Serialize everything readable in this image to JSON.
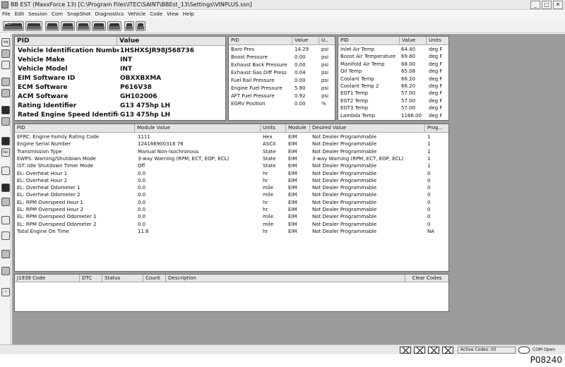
{
  "window": {
    "title": "BB EST (MaxxForce 13) [C:\\Program Files\\ITEC\\SAINT\\BBEst_13\\Settings\\VINPLUS.ssn]",
    "minimize": "_",
    "maximize": "□",
    "close": "✕"
  },
  "menu": [
    "File",
    "Edit",
    "Session",
    "Com",
    "SnapShot",
    "Diagnostics",
    "Vehicle",
    "Code",
    "View",
    "Help"
  ],
  "toolbar": {
    "buttons": [
      {
        "label": "ACT",
        "icon": "act-icon"
      },
      {
        "label": "",
        "icon": "module-connect-icon"
      },
      {
        "label": "",
        "icon": "module-icon"
      },
      {
        "label": "",
        "icon": "module-icon"
      },
      {
        "label": "",
        "icon": "module-icon"
      },
      {
        "label": "",
        "icon": "module-icon"
      },
      {
        "label": "",
        "icon": "module-icon"
      },
      {
        "label": "",
        "icon": "tool-icon"
      },
      {
        "label": "",
        "icon": "settings-icon"
      }
    ]
  },
  "sidebar": {
    "icons": [
      {
        "name": "vin-icon",
        "label": "VIN"
      },
      {
        "name": "tree-icon",
        "label": ""
      },
      {
        "name": "grid-icon",
        "label": ""
      },
      {
        "name": "gauge-icon",
        "label": ""
      },
      {
        "name": "engine-icon",
        "label": ""
      },
      {
        "name": "truck-icon",
        "label": ""
      },
      {
        "name": "test-icon",
        "label": ""
      },
      {
        "name": "camera-icon",
        "label": ""
      },
      {
        "name": "rec-icon",
        "label": "REC"
      },
      {
        "name": "stop-icon",
        "label": ""
      },
      {
        "name": "print-icon",
        "label": ""
      },
      {
        "name": "report-icon",
        "label": ""
      },
      {
        "name": "chart-icon",
        "label": ""
      },
      {
        "name": "calc-icon",
        "label": ""
      },
      {
        "name": "folder-icon",
        "label": ""
      },
      {
        "name": "hand-icon",
        "label": ""
      },
      {
        "name": "help-icon",
        "label": "?"
      }
    ]
  },
  "vin_panel": {
    "headers": [
      "PID",
      "Value"
    ],
    "rows": [
      {
        "pid": "Vehicle Identification Number",
        "value": "1HSHXSJR98J568736"
      },
      {
        "pid": "Vehicle Make",
        "value": "INT"
      },
      {
        "pid": "Vehicle Model",
        "value": "INT"
      },
      {
        "pid": "EIM Software ID",
        "value": "OBXXBXMA"
      },
      {
        "pid": "ECM Software",
        "value": "P616V38"
      },
      {
        "pid": "ACM Software",
        "value": "GH102006"
      },
      {
        "pid": "Rating Identifier",
        "value": "G13 475hp LH"
      },
      {
        "pid": "Rated Engine Speed Identifier",
        "value": "G13 475hp LH"
      }
    ]
  },
  "pid_panel_1": {
    "headers": [
      "PID",
      "Value",
      "U.."
    ],
    "rows": [
      {
        "pid": "Baro Pres",
        "value": "14.29",
        "unit": "psi"
      },
      {
        "pid": "Boost Pressure",
        "value": "0.00",
        "unit": "psi"
      },
      {
        "pid": "Exhaust Back Pressure",
        "value": "0.00",
        "unit": "psi"
      },
      {
        "pid": "Exhaust Gas Diff Press",
        "value": "0.04",
        "unit": "psi"
      },
      {
        "pid": "Fuel Rail Pressure",
        "value": "0.00",
        "unit": "psi"
      },
      {
        "pid": "Engine Fuel Pressure",
        "value": "5.80",
        "unit": "psi"
      },
      {
        "pid": "AFT Fuel Pressure",
        "value": "0.92",
        "unit": "psi"
      },
      {
        "pid": "EGRV Position",
        "value": "0.00",
        "unit": "%"
      }
    ]
  },
  "pid_panel_2": {
    "headers": [
      "PID",
      "Value",
      "Units"
    ],
    "rows": [
      {
        "pid": "Inlet Air Temp",
        "value": "64.40",
        "unit": "deg F"
      },
      {
        "pid": "Boost Air Temperature",
        "value": "69.80",
        "unit": "deg F"
      },
      {
        "pid": "Manifold Air Temp",
        "value": "68.00",
        "unit": "deg F"
      },
      {
        "pid": "Oil Temp",
        "value": "65.08",
        "unit": "deg F"
      },
      {
        "pid": "Coolant Temp",
        "value": "66.20",
        "unit": "deg F"
      },
      {
        "pid": "Coolant Temp 2",
        "value": "66.20",
        "unit": "deg F"
      },
      {
        "pid": "EGT1 Temp",
        "value": "57.00",
        "unit": "deg F"
      },
      {
        "pid": "EGT2 Temp",
        "value": "57.00",
        "unit": "deg F"
      },
      {
        "pid": "EGT3 Temp",
        "value": "57.00",
        "unit": "deg F"
      },
      {
        "pid": "Lambda Temp",
        "value": "1166.00",
        "unit": "deg F"
      }
    ]
  },
  "module_panel": {
    "headers": [
      "PID",
      "Module Value",
      "Units",
      "Module",
      "Desired Value",
      "Prog..."
    ],
    "rows": [
      {
        "pid": "EFRC: Engine Family Rating Code",
        "value": "1111",
        "unit": "Hex",
        "module": "EIM",
        "desired": "Not Dealer Programmable",
        "prog": "1"
      },
      {
        "pid": "Engine Serial Number",
        "value": "124166900316 76",
        "unit": "ASCII",
        "module": "EIM",
        "desired": "Not Dealer Programmable",
        "prog": "1"
      },
      {
        "pid": "Transmission Type",
        "value": "Manual Non-Isochronous",
        "unit": "State",
        "module": "EIM",
        "desired": "Not Dealer Programmable",
        "prog": "1"
      },
      {
        "pid": "EWPS: Warning/Shutdown Mode",
        "value": "3-way Warning    (RPM, ECT, EOP, ECL)",
        "unit": "State",
        "module": "EIM",
        "desired": "3-way Warning    (RPM, ECT, EOP, ECL)",
        "prog": "1"
      },
      {
        "pid": "IST: Idle Shutdown Timer Mode",
        "value": "Off",
        "unit": "State",
        "module": "EIM",
        "desired": "Not Dealer Programmable",
        "prog": "1"
      },
      {
        "pid": "EL: Overheat Hour 1",
        "value": "0.0",
        "unit": "hr",
        "module": "EIM",
        "desired": "Not Dealer Programmable",
        "prog": "0"
      },
      {
        "pid": "EL: Overheat Hour 2",
        "value": "0.0",
        "unit": "hr",
        "module": "EIM",
        "desired": "Not Dealer Programmable",
        "prog": "0"
      },
      {
        "pid": "EL: Overheat Odometer 1",
        "value": "0.0",
        "unit": "mile",
        "module": "EIM",
        "desired": "Not Dealer Programmable",
        "prog": "0"
      },
      {
        "pid": "EL: Overheat Odometer 2",
        "value": "0.0",
        "unit": "mile",
        "module": "EIM",
        "desired": "Not Dealer Programmable",
        "prog": "0"
      },
      {
        "pid": "EL: RPM Overspeed Hour 1",
        "value": "0.0",
        "unit": "hr",
        "module": "EIM",
        "desired": "Not Dealer Programmable",
        "prog": "0"
      },
      {
        "pid": "EL: RPM Overspeed Hour 2",
        "value": "0.0",
        "unit": "hr",
        "module": "EIM",
        "desired": "Not Dealer Programmable",
        "prog": "0"
      },
      {
        "pid": "EL: RPM Overspeed Odometer 1",
        "value": "0.0",
        "unit": "mile",
        "module": "EIM",
        "desired": "Not Dealer Programmable",
        "prog": "0"
      },
      {
        "pid": "EL: RPM Overspeed Odometer 2",
        "value": "0.0",
        "unit": "mile",
        "module": "EIM",
        "desired": "Not Dealer Programmable",
        "prog": "0"
      },
      {
        "pid": "Total Engine On Time",
        "value": "11.6",
        "unit": "hr",
        "module": "EIM",
        "desired": "Not Dealer Programmable",
        "prog": "NA"
      }
    ]
  },
  "dtc_panel": {
    "headers": [
      "J1939 Code",
      "DTC",
      "Status",
      "Count",
      "Description"
    ],
    "clear_codes_label": "Clear Codes"
  },
  "statusbar": {
    "active_codes": "Active Codes: 00",
    "com_status": "COM Open"
  },
  "figure_id": "P08240"
}
